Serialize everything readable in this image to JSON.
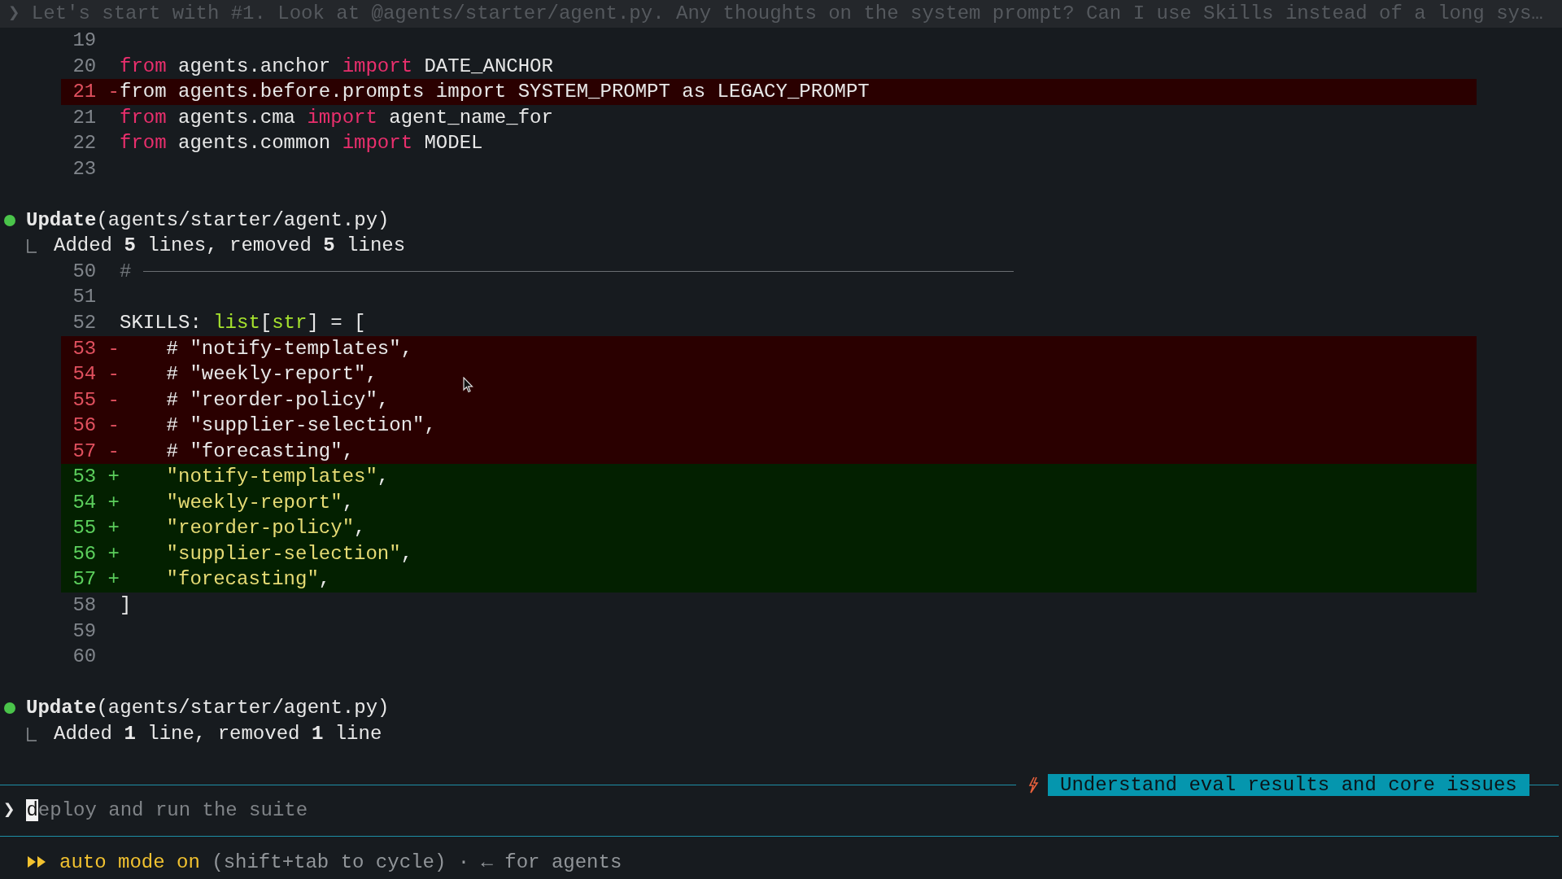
{
  "previous_prompt": {
    "marker": "❯",
    "text": "Let's start with #1. Look at @agents/starter/agent.py. Any thoughts on the system prompt? Can I use Skills instead of a long sys…"
  },
  "transcript": [
    {
      "kind": "diff",
      "lines": [
        {
          "number": "19",
          "kind": "context"
        },
        {
          "number": "20",
          "kind": "context",
          "segments": [
            {
              "kind": "keyword",
              "text": "from"
            },
            {
              "kind": "plain",
              "text": " agents.anchor "
            },
            {
              "kind": "keyword",
              "text": "import"
            },
            {
              "kind": "plain",
              "text": " DATE_ANCHOR"
            }
          ]
        },
        {
          "number": "21",
          "kind": "removed",
          "sign": "-",
          "segments": [
            {
              "kind": "plain",
              "text": "from agents.before.prompts import SYSTEM_PROMPT as LEGACY_PROMPT"
            }
          ]
        },
        {
          "number": "21",
          "kind": "context",
          "segments": [
            {
              "kind": "keyword",
              "text": "from"
            },
            {
              "kind": "plain",
              "text": " agents.cma "
            },
            {
              "kind": "keyword",
              "text": "import"
            },
            {
              "kind": "plain",
              "text": " agent_name_for"
            }
          ]
        },
        {
          "number": "22",
          "kind": "context",
          "segments": [
            {
              "kind": "keyword",
              "text": "from"
            },
            {
              "kind": "plain",
              "text": " agents.common "
            },
            {
              "kind": "keyword",
              "text": "import"
            },
            {
              "kind": "plain",
              "text": " MODEL"
            }
          ]
        },
        {
          "number": "23",
          "kind": "context"
        }
      ]
    },
    {
      "kind": "tool_call",
      "title": "**Update**(agents/starter/agent.py)",
      "summary": "Added **5** lines, removed **5** lines"
    },
    {
      "kind": "diff",
      "lines": [
        {
          "number": "50",
          "kind": "context",
          "segments": [
            {
              "kind": "comment",
              "text": "#"
            },
            {
              "kind": "rule"
            }
          ]
        },
        {
          "number": "51",
          "kind": "context"
        },
        {
          "number": "52",
          "kind": "context",
          "segments": [
            {
              "kind": "plain",
              "text": "SKILLS: "
            },
            {
              "kind": "type",
              "text": "list"
            },
            {
              "kind": "plain",
              "text": "["
            },
            {
              "kind": "type",
              "text": "str"
            },
            {
              "kind": "plain",
              "text": "] = ["
            }
          ]
        },
        {
          "number": "53",
          "kind": "removed",
          "sign": "-",
          "segments": [
            {
              "kind": "plain",
              "text": "    # \"notify-templates\","
            }
          ]
        },
        {
          "number": "54",
          "kind": "removed",
          "sign": "-",
          "segments": [
            {
              "kind": "plain",
              "text": "    # \"weekly-report\","
            }
          ]
        },
        {
          "number": "55",
          "kind": "removed",
          "sign": "-",
          "segments": [
            {
              "kind": "plain",
              "text": "    # \"reorder-policy\","
            }
          ]
        },
        {
          "number": "56",
          "kind": "removed",
          "sign": "-",
          "segments": [
            {
              "kind": "plain",
              "text": "    # \"supplier-selection\","
            }
          ]
        },
        {
          "number": "57",
          "kind": "removed",
          "sign": "-",
          "segments": [
            {
              "kind": "plain",
              "text": "    # \"forecasting\","
            }
          ]
        },
        {
          "number": "53",
          "kind": "added",
          "sign": "+",
          "segments": [
            {
              "kind": "string",
              "text": "    \"notify-templates\""
            },
            {
              "kind": "plain",
              "text": ","
            }
          ]
        },
        {
          "number": "54",
          "kind": "added",
          "sign": "+",
          "segments": [
            {
              "kind": "string",
              "text": "    \"weekly-report\""
            },
            {
              "kind": "plain",
              "text": ","
            }
          ]
        },
        {
          "number": "55",
          "kind": "added",
          "sign": "+",
          "segments": [
            {
              "kind": "string",
              "text": "    \"reorder-policy\""
            },
            {
              "kind": "plain",
              "text": ","
            }
          ]
        },
        {
          "number": "56",
          "kind": "added",
          "sign": "+",
          "segments": [
            {
              "kind": "string",
              "text": "    \"supplier-selection\""
            },
            {
              "kind": "plain",
              "text": ","
            }
          ]
        },
        {
          "number": "57",
          "kind": "added",
          "sign": "+",
          "segments": [
            {
              "kind": "string",
              "text": "    \"forecasting\""
            },
            {
              "kind": "plain",
              "text": ","
            }
          ]
        },
        {
          "number": "58",
          "kind": "context",
          "segments": [
            {
              "kind": "plain",
              "text": "]"
            }
          ]
        },
        {
          "number": "59",
          "kind": "context"
        },
        {
          "number": "60",
          "kind": "context"
        }
      ]
    },
    {
      "kind": "tool_call",
      "title": "**Update**(agents/starter/agent.py)",
      "summary": "Added **1** line, removed **1** line"
    }
  ],
  "task_tag": "Understand eval results and core issues",
  "input": {
    "marker": "❯",
    "placeholder": "deploy and run the suite"
  },
  "footer": {
    "mode": "auto mode on",
    "hint": "(shift+tab to cycle) · ← for agents"
  }
}
